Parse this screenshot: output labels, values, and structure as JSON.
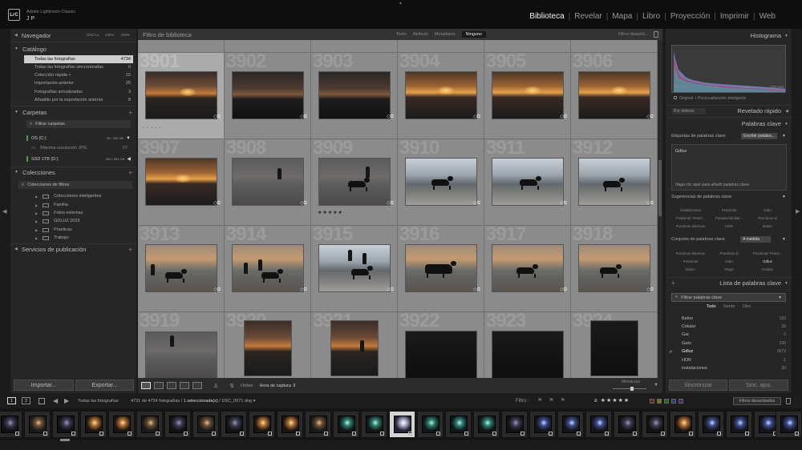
{
  "app": {
    "logo": "LrC",
    "name": "Adobe Lightroom Classic",
    "user": "J P"
  },
  "modules": [
    "Biblioteca",
    "Revelar",
    "Mapa",
    "Libro",
    "Proyección",
    "Imprimir",
    "Web"
  ],
  "active_module": "Biblioteca",
  "left_panel": {
    "navigator": {
      "title": "Navegador",
      "options": [
        "ENCAJ",
        "100%",
        "200%"
      ]
    },
    "catalog": {
      "title": "Catálogo",
      "rows": [
        {
          "label": "Todas las fotografías",
          "count": "4734",
          "selected": true
        },
        {
          "label": "Todas las fotografías sincronizadas",
          "count": "0"
        },
        {
          "label": "Colección rápida +",
          "count": "15"
        },
        {
          "label": "Importación anterior",
          "count": "25"
        },
        {
          "label": "Fotografías actualizadas",
          "count": "3"
        },
        {
          "label": "Añadido por la exportación anterior",
          "count": "8"
        }
      ]
    },
    "folders": {
      "title": "Carpetas",
      "filter_label": "Filtrar carpetas",
      "drives": [
        {
          "label": "OS (C:)",
          "capacity": "95 / 455 GB"
        },
        {
          "label": "SSD 1TB (D:)",
          "capacity": "364 / 894 GB"
        }
      ],
      "subfolder": {
        "label": "Máxima resolución JPG",
        "count": "27"
      }
    },
    "collections": {
      "title": "Colecciones",
      "filter_label": "Colecciones de filtros",
      "items": [
        "Colecciones inteligentes",
        "Familia",
        "Fotos externas",
        "GDLUZ 2023",
        "Practicas",
        "Trabajo"
      ]
    },
    "publish": {
      "title": "Servicios de publicación"
    },
    "import_label": "Importar...",
    "export_label": "Exportar..."
  },
  "center": {
    "filter_title": "Filtro de biblioteca",
    "filter_options": [
      "Texto",
      "Atributo",
      "Metadatos",
      "Ninguno"
    ],
    "filter_selected": "Ninguno",
    "filters_off": "Filtros desactiv...",
    "rows": [
      [
        "",
        "",
        "",
        "",
        "",
        ""
      ],
      [
        "3901",
        "3902",
        "3903",
        "3904",
        "3905",
        "3906"
      ],
      [
        "3907",
        "3908",
        "3909",
        "3910",
        "3911",
        "3912"
      ],
      [
        "3913",
        "3914",
        "3915",
        "3916",
        "3917",
        "3918"
      ],
      [
        "3919",
        "3920",
        "3921",
        "3922",
        "3923",
        "3924"
      ]
    ],
    "selected_rating": "★★★★★",
    "selected_stars_empty": "• • • • •",
    "order_label": "Orden",
    "sort_value": "Hora de captura",
    "thumbs_label": "Miniaturas"
  },
  "right_panel": {
    "histogram": {
      "title": "Histograma",
      "iso": "ISO 1600",
      "focal": "24 mm",
      "aperture": "ƒ / 4,5",
      "shutter": "1/60 seg"
    },
    "preview": "Original + Previsualización inteligente",
    "quick_develop": {
      "title": "Revelado rápido",
      "preset": "Por defecto"
    },
    "keywords": {
      "title": "Palabras clave",
      "tags_label": "Etiquetas de palabras clave",
      "tags_mode": "Escribir palabra...",
      "current": "Gdluz",
      "hint": "Haga clic aquí para añadir palabras clave",
      "suggestions_title": "Sugerencias de palabras clave",
      "suggestions": [
        "instalaciones",
        "Practicas",
        "Gato",
        "Practicas\" Practi...",
        "Posada familiar...",
        "Practicas al",
        "Practicas alumnos",
        "HDR",
        "Baloo"
      ],
      "set_title": "Conjunto de palabras clave",
      "set_value": "A medida",
      "set_items": [
        "Practicas alumnos",
        "Practicas al",
        "Practicas\" Practi...",
        "Practicas",
        "Gato",
        "Gdluz",
        "Baloo",
        "Playa",
        "Celular"
      ]
    },
    "keyword_list": {
      "title": "Lista de palabras clave",
      "filter_label": "Filtrar palabras clave",
      "tabs": [
        "Todo",
        "Gente",
        "Otro"
      ],
      "selected_tab": "Todo",
      "items": [
        {
          "label": "Baloo",
          "count": "192"
        },
        {
          "label": "Celular",
          "count": "25"
        },
        {
          "label": "Gar",
          "count": "0"
        },
        {
          "label": "Gato",
          "count": "230"
        },
        {
          "label": "Gdluz",
          "count": "3972",
          "checked": true
        },
        {
          "label": "HDR",
          "count": "1"
        },
        {
          "label": "instalaciones",
          "count": "30"
        }
      ]
    },
    "sync_label": "Sincronizar",
    "sync_settings_label": "Sinc. ajus."
  },
  "filmbar": {
    "monitor1": "1",
    "monitor2": "2",
    "source": "Todas las fotografías",
    "count_text": "4731 de 4734 fotografías /",
    "selected_text": "1 seleccionada(s)",
    "file_text": "/ DSC_0071.dng ▾",
    "filter_label": "Filtro :",
    "flags": "⚑ ⚑ ⚑",
    "star_filter": "≥ ★★★★★",
    "filters_off": "Filtros desactivados"
  },
  "colors": {
    "bg": "#1b1b1b",
    "panel": "#262626",
    "grid_cell": "#8b8b8b",
    "selected_cell": "#ababab",
    "accent_text": "#f2f2f2"
  }
}
